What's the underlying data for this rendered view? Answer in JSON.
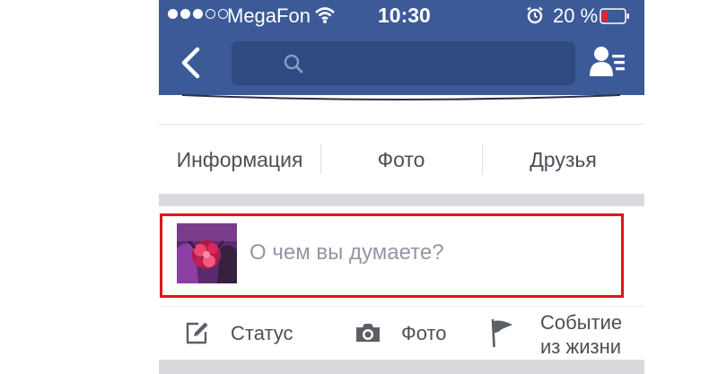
{
  "status_bar": {
    "carrier": "MegaFon",
    "time": "10:30",
    "battery": "20 %",
    "signal_bars_filled": 3,
    "signal_bars_total": 5
  },
  "header": {
    "search_placeholder": "",
    "icons": [
      "back-icon",
      "search-icon",
      "friends-icon"
    ]
  },
  "tabs": [
    {
      "label": "Информация"
    },
    {
      "label": "Фото"
    },
    {
      "label": "Друзья"
    }
  ],
  "composer": {
    "placeholder": "О чем вы думаете?"
  },
  "actions": [
    {
      "label": "Статус",
      "icon": "edit-icon"
    },
    {
      "label": "Фото",
      "icon": "camera-icon"
    },
    {
      "label_line1": "Событие",
      "label_line2": "из жизни",
      "icon": "flag-icon"
    }
  ],
  "colors": {
    "header_blue": "#3c5a98",
    "search_bg": "#2f4a80",
    "highlight_red": "#e0141e",
    "text_gray": "#4b4f56",
    "placeholder_gray": "#9197a3"
  }
}
